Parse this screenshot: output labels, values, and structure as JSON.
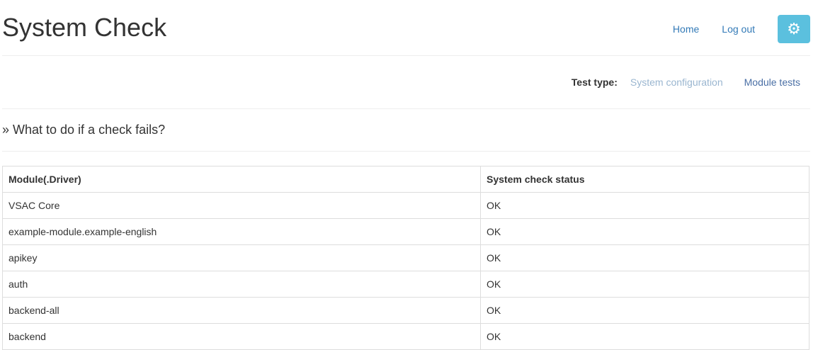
{
  "header": {
    "title": "System Check",
    "nav": {
      "home": "Home",
      "logout": "Log out",
      "settings_icon": "gear-icon"
    }
  },
  "test_type": {
    "label": "Test type:",
    "options": [
      "System configuration",
      "Module tests"
    ]
  },
  "help": {
    "text": "» What to do if a check fails?"
  },
  "table": {
    "columns": [
      "Module(.Driver)",
      "System check status"
    ],
    "rows": [
      [
        "VSAC Core",
        "OK"
      ],
      [
        "example-module.example-english",
        "OK"
      ],
      [
        "apikey",
        "OK"
      ],
      [
        "auth",
        "OK"
      ],
      [
        "backend-all",
        "OK"
      ],
      [
        "backend",
        "OK"
      ]
    ]
  },
  "colors": {
    "link": "#337ab7",
    "settings_button": "#5bc0de"
  }
}
